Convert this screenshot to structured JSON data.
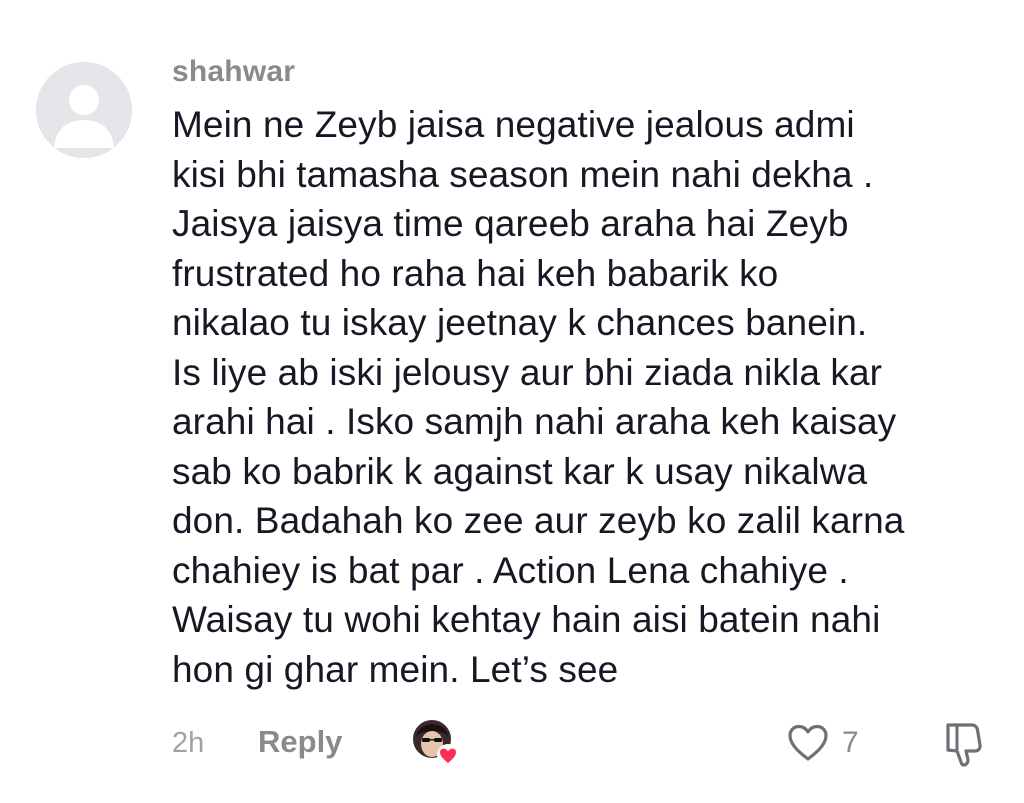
{
  "comment": {
    "username": "shahwar",
    "text": "Mein ne Zeyb jaisa negative jealous admi\nkisi bhi tamasha season mein nahi dekha .\nJaisya jaisya time qareeb araha hai Zeyb\nfrustrated ho raha hai keh babarik ko\nnikalao tu iskay jeetnay k chances banein.\nIs liye ab iski jelousy aur bhi ziada nikla kar\narahi hai . Isko samjh nahi araha keh kaisay\nsab ko babrik k against kar k usay nikalwa\ndon. Badahah ko zee aur zeyb ko zalil karna\nchahiey is bat par . Action Lena chahiye .\nWaisay tu wohi kehtay hain aisi batein nahi\nhon gi ghar mein. Let’s see",
    "timestamp": "2h",
    "reply_label": "Reply",
    "like_count": "7"
  },
  "icons": {
    "avatar": "default-avatar-icon",
    "creator_liked": "creator-liked-avatar-icon",
    "like": "heart-outline-icon",
    "dislike": "thumbs-down-outline-icon"
  },
  "colors": {
    "username": "#8a8a8e",
    "text": "#161823",
    "meta": "#a1a1a6",
    "avatar_bg": "#e5e5ea",
    "heart_badge": "#fe2c55"
  }
}
